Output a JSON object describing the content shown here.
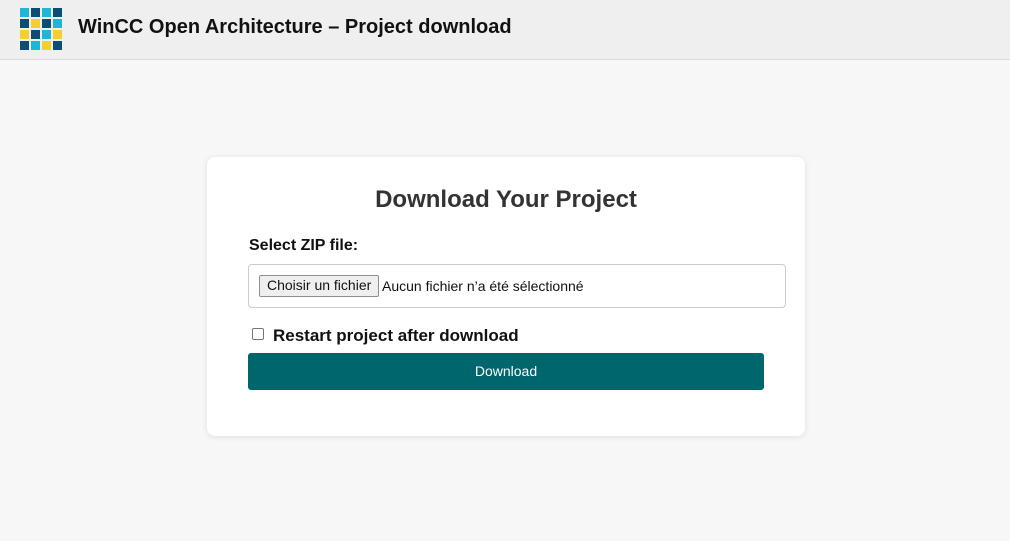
{
  "header": {
    "title": "WinCC Open Architecture – Project download",
    "logo_colors": [
      "#1eb5d6",
      "#0d4d73",
      "#1eb5d6",
      "#0d4d73",
      "#0d4d73",
      "#f4cf2e",
      "#0d4d73",
      "#1eb5d6",
      "#f4cf2e",
      "#0d4d73",
      "#1eb5d6",
      "#f4cf2e",
      "#0d4d73",
      "#1eb5d6",
      "#f4cf2e",
      "#0d4d73"
    ]
  },
  "card": {
    "title": "Download Your Project",
    "file_label": "Select ZIP file:",
    "file_button_label": "Choisir un fichier",
    "file_status": "Aucun fichier n’a été sélectionné",
    "restart_label": "Restart project after download",
    "restart_checked": false,
    "download_label": "Download"
  },
  "colors": {
    "accent": "#00666e",
    "background": "#f7f7f7",
    "header_background": "#efefef"
  }
}
